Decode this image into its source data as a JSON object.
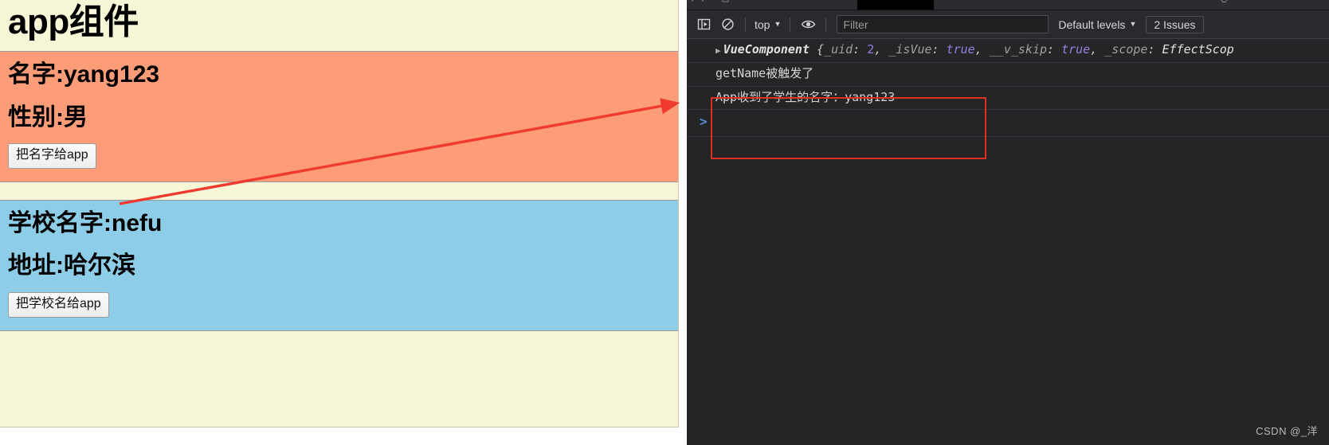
{
  "page": {
    "app_title": "app组件",
    "student": {
      "name_line": "名字:yang123",
      "gender_line": "性别:男",
      "button_label": "把名字给app"
    },
    "school": {
      "name_line": "学校名字:nefu",
      "address_line": "地址:哈尔滨",
      "button_label": "把学校名给app"
    },
    "colors": {
      "app_bg": "#f7f7d7",
      "student_bg": "#fc9c78",
      "school_bg": "#8ecde8"
    }
  },
  "devtools": {
    "tabstrip": {
      "left_icons": "⌐⌐ ▭",
      "right_icon": "⟳"
    },
    "toolbar": {
      "sidebar_toggle_icon": "sidebar-toggle-icon",
      "clear_console_icon": "clear-console-icon",
      "context_label": "top",
      "caret": "▼",
      "eye_icon": "eye-icon",
      "filter_placeholder": "Filter",
      "filter_value": "",
      "levels_label": "Default levels",
      "levels_caret": "▼",
      "issues_label": "2 Issues"
    },
    "console": {
      "rows": [
        {
          "type": "object",
          "triangle": "▶",
          "class_name": "VueComponent",
          "open_brace": " {",
          "props": [
            {
              "key": "_uid",
              "sep": ": ",
              "value": "2",
              "value_kind": "num",
              "comma": ", "
            },
            {
              "key": "_isVue",
              "sep": ": ",
              "value": "true",
              "value_kind": "bool",
              "comma": ", "
            },
            {
              "key": "__v_skip",
              "sep": ": ",
              "value": "true",
              "value_kind": "bool",
              "comma": ", "
            },
            {
              "key": "_scope",
              "sep": ": ",
              "value": "EffectScop",
              "value_kind": "type",
              "comma": ""
            }
          ]
        },
        {
          "type": "text",
          "text": "getName被触发了"
        },
        {
          "type": "text",
          "text": "App收到了学生的名字：yang123"
        }
      ],
      "prompt_caret": ">"
    },
    "annotation": {
      "box_color": "#e03025",
      "arrow_color": "#f03a2e"
    },
    "watermark": "CSDN @_洋"
  }
}
